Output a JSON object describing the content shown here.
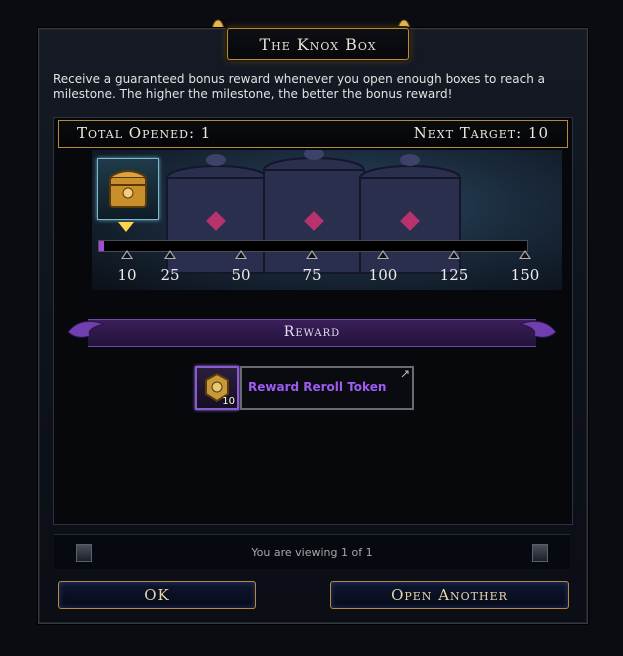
{
  "window": {
    "title": "The Knox Box"
  },
  "intro": "Receive a guaranteed bonus reward whenever you open enough boxes to reach a milestone. The higher the milestone, the better the bonus reward!",
  "stats": {
    "total_opened": "Total Opened: 1",
    "next_target": "Next Target: 10"
  },
  "progress": {
    "value": 1,
    "max": 150
  },
  "milestones": [
    "10",
    "25",
    "50",
    "75",
    "100",
    "125",
    "150"
  ],
  "reward": {
    "header": "Reward",
    "item_name": "Reward Reroll Token",
    "item_quantity": "10"
  },
  "pager": {
    "text": "You are viewing 1 of 1"
  },
  "buttons": {
    "ok": "OK",
    "open_another": "Open Another"
  },
  "colors": {
    "gold": "#b58a3a",
    "purple": "#9d5cf2",
    "progress_fill": "#a64bd8"
  }
}
